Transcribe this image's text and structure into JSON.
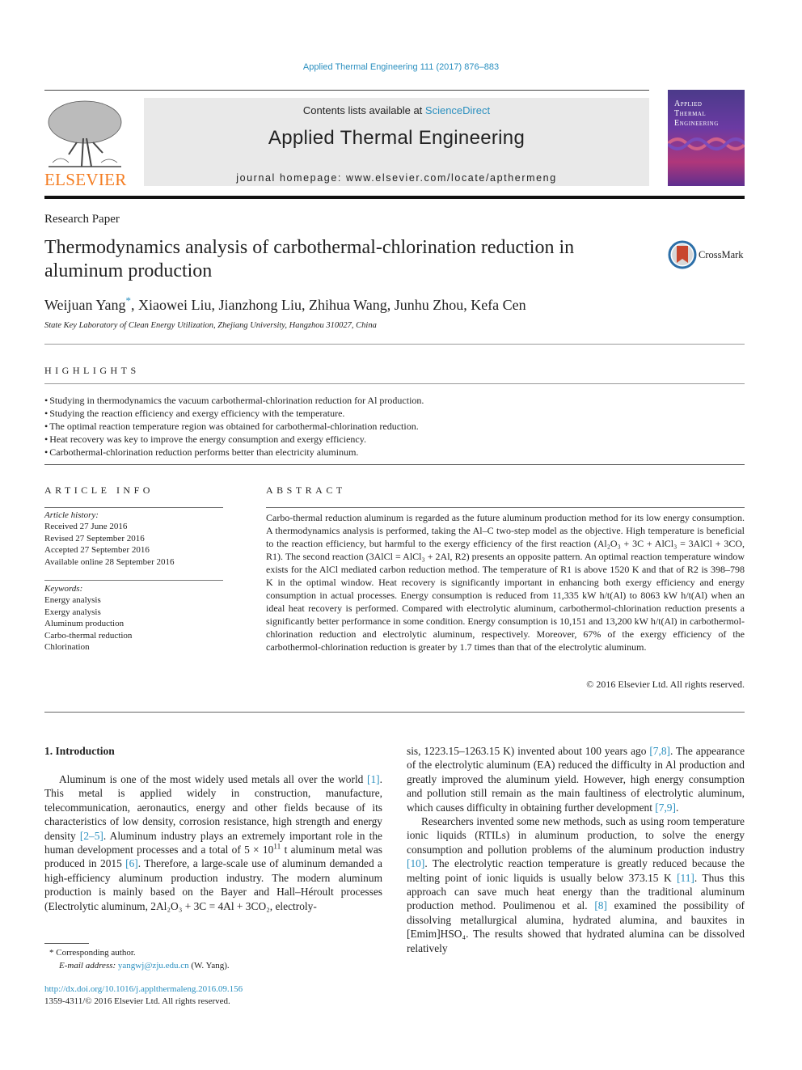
{
  "citation": "Applied Thermal Engineering 111 (2017) 876–883",
  "header": {
    "contents_prefix": "Contents lists available at ",
    "sciencedirect": "ScienceDirect",
    "journal_name": "Applied Thermal Engineering",
    "homepage": "journal homepage: www.elsevier.com/locate/apthermeng",
    "publisher": "ELSEVIER",
    "cover_title_1": "Applied",
    "cover_title_2": "Thermal",
    "cover_title_3": "Engineering"
  },
  "article_type": "Research Paper",
  "title": "Thermodynamics analysis of carbothermal-chlorination reduction in aluminum production",
  "crossmark_label": "CrossMark",
  "authors": {
    "first": "Weijuan Yang",
    "star": "*",
    "rest": ", Xiaowei Liu, Jianzhong Liu, Zhihua Wang, Junhu Zhou, Kefa Cen"
  },
  "affiliation": "State Key Laboratory of Clean Energy Utilization, Zhejiang University, Hangzhou 310027, China",
  "highlights": {
    "heading": "HIGHLIGHTS",
    "items": [
      "Studying in thermodynamics the vacuum carbothermal-chlorination reduction for Al production.",
      "Studying the reaction efficiency and exergy efficiency with the temperature.",
      "The optimal reaction temperature region was obtained for carbothermal-chlorination reduction.",
      "Heat recovery was key to improve the energy consumption and exergy efficiency.",
      "Carbothermal-chlorination reduction performs better than electricity aluminum."
    ]
  },
  "article_info": {
    "heading": "ARTICLE INFO",
    "history_label": "Article history:",
    "history": [
      "Received 27 June 2016",
      "Revised 27 September 2016",
      "Accepted 27 September 2016",
      "Available online 28 September 2016"
    ],
    "keywords_label": "Keywords:",
    "keywords": [
      "Energy analysis",
      "Exergy analysis",
      "Aluminum production",
      "Carbo-thermal reduction",
      "Chlorination"
    ]
  },
  "abstract": {
    "heading": "ABSTRACT",
    "p1": "Carbo-thermal reduction aluminum is regarded as the future aluminum production method for its low energy consumption. A thermodynamics analysis is performed, taking the Al–C two-step model as the objective. High temperature is beneficial to the reaction efficiency, but harmful to the exergy efficiency of the first reaction (",
    "r1": "Al₂O₃ + 3C + AlCl₃ = 3AlCl + 3CO, R1",
    "p2": "). The second reaction (",
    "r2": "3AlCl = AlCl₃ + 2Al, R2",
    "p3": ") presents an opposite pattern. An optimal reaction temperature window exists for the AlCl mediated carbon reduction method. The temperature of R1 is above 1520 K and that of R2 is 398–798 K in the optimal window. Heat recovery is significantly important in enhancing both exergy efficiency and energy consumption in actual processes. Energy consumption is reduced from 11,335 kW h/t(Al) to 8063 kW h/t(Al) when an ideal heat recovery is performed. Compared with electrolytic aluminum, carbothermol-chlorination reduction presents a significantly better performance in some condition. Energy consumption is 10,151 and 13,200 kW h/t(Al) in carbothermol-chlorination reduction and electrolytic aluminum, respectively. Moreover, 67% of the exergy efficiency of the carbothermol-chlorination reduction is greater by 1.7 times than that of the electrolytic aluminum.",
    "copyright": "© 2016 Elsevier Ltd. All rights reserved."
  },
  "intro": {
    "heading": "1. Introduction",
    "left_a": "Aluminum is one of the most widely used metals all over the world ",
    "ref1": "[1]",
    "left_b": ". This metal is applied widely in construction, manufacture, telecommunication, aeronautics, energy and other fields because of its characteristics of low density, corrosion resistance, high strength and energy density ",
    "ref2": "[2–5]",
    "left_c": ". Aluminum industry plays an extremely important role in the human development processes and a total of 5 × 10",
    "exp": "11",
    "left_d": " t aluminum metal was produced in 2015 ",
    "ref3": "[6]",
    "left_e": ". Therefore, a large-scale use of aluminum demanded a high-efficiency aluminum production industry. The modern aluminum production is mainly based on the Bayer and Hall–Héroult processes (Electrolytic aluminum, 2Al₂O₃ + 3C = 4Al + 3CO₂, electroly-",
    "right_a": "sis, 1223.15–1263.15 K) invented about 100 years ago ",
    "ref4": "[7,8]",
    "right_b": ". The appearance of the electrolytic aluminum (EA) reduced the difficulty in Al production and greatly improved the aluminum yield. However, high energy consumption and pollution still remain as the main faultiness of electrolytic aluminum, which causes difficulty in obtaining further development ",
    "ref5": "[7,9]",
    "right_c": ".",
    "right_p2a": "Researchers invented some new methods, such as using room temperature ionic liquids (RTILs) in aluminum production, to solve the energy consumption and pollution problems of the aluminum production industry ",
    "ref6": "[10]",
    "right_p2b": ". The electrolytic reaction temperature is greatly reduced because the melting point of ionic liquids is usually below 373.15 K ",
    "ref7": "[11]",
    "right_p2c": ". Thus this approach can save much heat energy than the traditional aluminum production method. Poulimenou et al. ",
    "ref8": "[8]",
    "right_p2d": " examined the possibility of dissolving metallurgical alumina, hydrated alumina, and bauxites in [Emim]HSO₄. The results showed that hydrated alumina can be dissolved relatively"
  },
  "footnote": {
    "star": "*",
    "corresponding": "Corresponding author.",
    "email_label": "E-mail address:",
    "email": "yangwj@zju.edu.cn",
    "email_suffix": " (W. Yang)."
  },
  "doi": {
    "link": "http://dx.doi.org/10.1016/j.applthermaleng.2016.09.156",
    "issn": "1359-4311/© 2016 Elsevier Ltd. All rights reserved."
  }
}
